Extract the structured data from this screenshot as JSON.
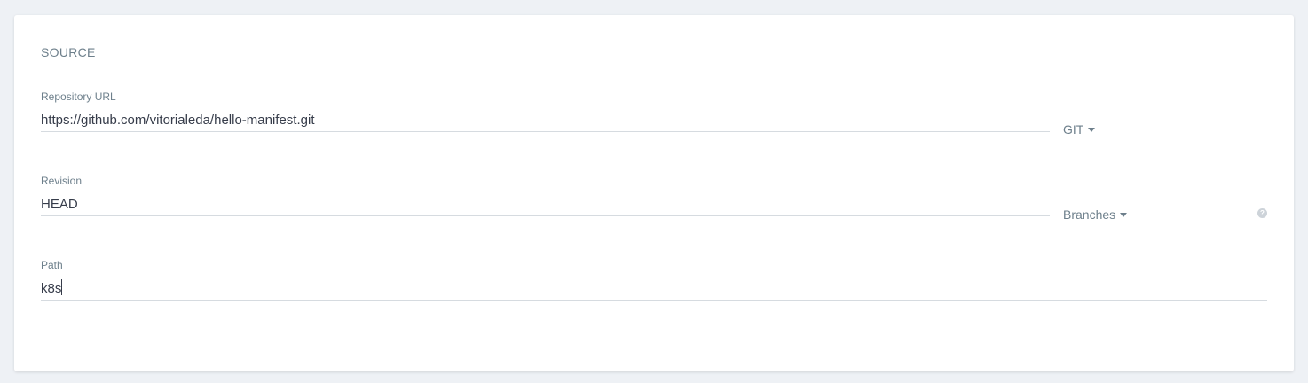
{
  "section": {
    "title": "SOURCE"
  },
  "repository": {
    "label": "Repository URL",
    "value": "https://github.com/vitorialeda/hello-manifest.git",
    "type_dropdown": "GIT"
  },
  "revision": {
    "label": "Revision",
    "value": "HEAD",
    "ref_dropdown": "Branches"
  },
  "path": {
    "label": "Path",
    "value": "k8s"
  },
  "help": {
    "glyph": "?"
  },
  "colors": {
    "background": "#eef1f5",
    "card": "#ffffff",
    "label": "#6d7f8b",
    "text": "#363c4a",
    "underline": "#d6dbe0"
  }
}
